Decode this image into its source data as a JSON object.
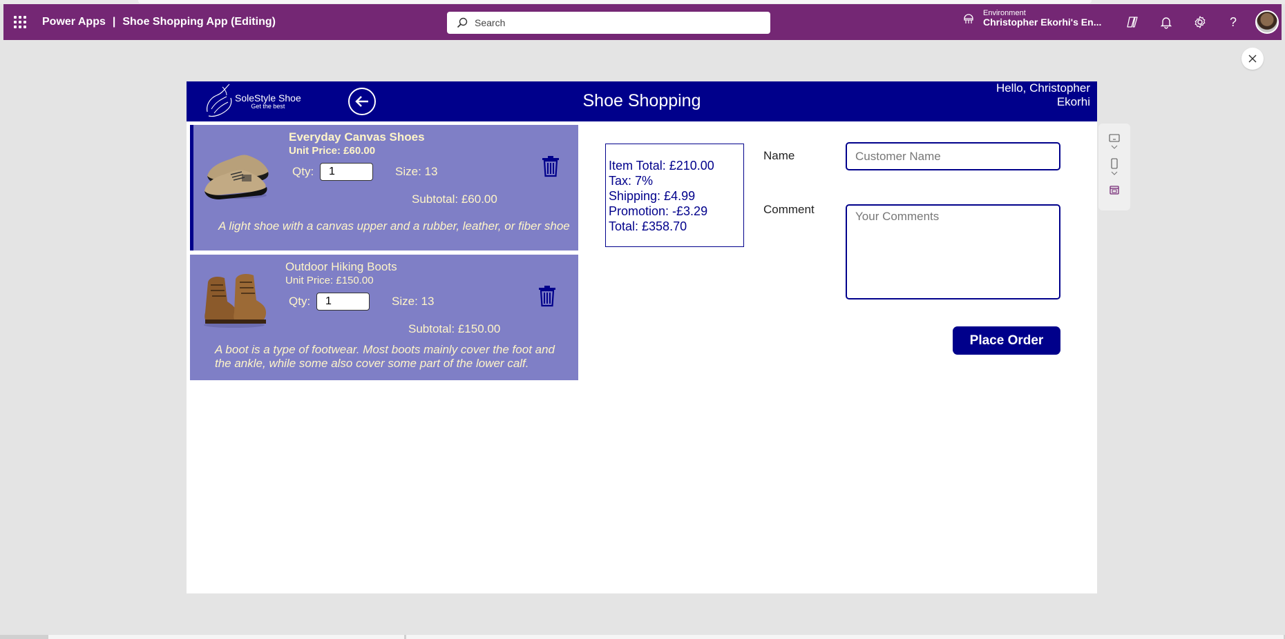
{
  "powerapps": {
    "product": "Power Apps",
    "separator": "|",
    "app_title": "Shoe Shopping App (Editing)",
    "search_placeholder": "Search",
    "environment_label": "Environment",
    "environment_name": "Christopher Ekorhi's En...",
    "brand_color": "#742774"
  },
  "app": {
    "header_color": "#00008b",
    "logo": {
      "name": "SoleStyle Shoe",
      "tagline": "Get the best"
    },
    "title": "Shoe Shopping",
    "greeting_line1": "Hello, Christopher",
    "greeting_line2": "Ekorhi"
  },
  "cart": {
    "items": [
      {
        "name": "Everyday Canvas Shoes",
        "unit_price": "Unit Price: £60.00",
        "qty_label": "Qty:",
        "qty": "1",
        "size": "Size: 13",
        "subtotal": "Subtotal: £60.00",
        "description": "A light shoe with a canvas upper and a rubber, leather, or fiber shoe",
        "selected": true
      },
      {
        "name": "Outdoor Hiking Boots",
        "unit_price": "Unit Price: £150.00",
        "qty_label": "Qty:",
        "qty": "1",
        "size": "Size: 13",
        "subtotal": "Subtotal: £150.00",
        "description": "A boot is a type of footwear. Most boots mainly cover the foot and the ankle, while some also cover some part of the lower calf.",
        "selected": false
      }
    ]
  },
  "summary": {
    "item_total": "Item Total: £210.00",
    "tax": "Tax: 7%",
    "shipping": "Shipping: £4.99",
    "promotion": "Promotion: -£3.29",
    "total": "Total: £358.70"
  },
  "form": {
    "name_label": "Name",
    "name_placeholder": "Customer Name",
    "comment_label": "Comment",
    "comment_placeholder": "Your Comments",
    "place_order_label": "Place Order"
  }
}
